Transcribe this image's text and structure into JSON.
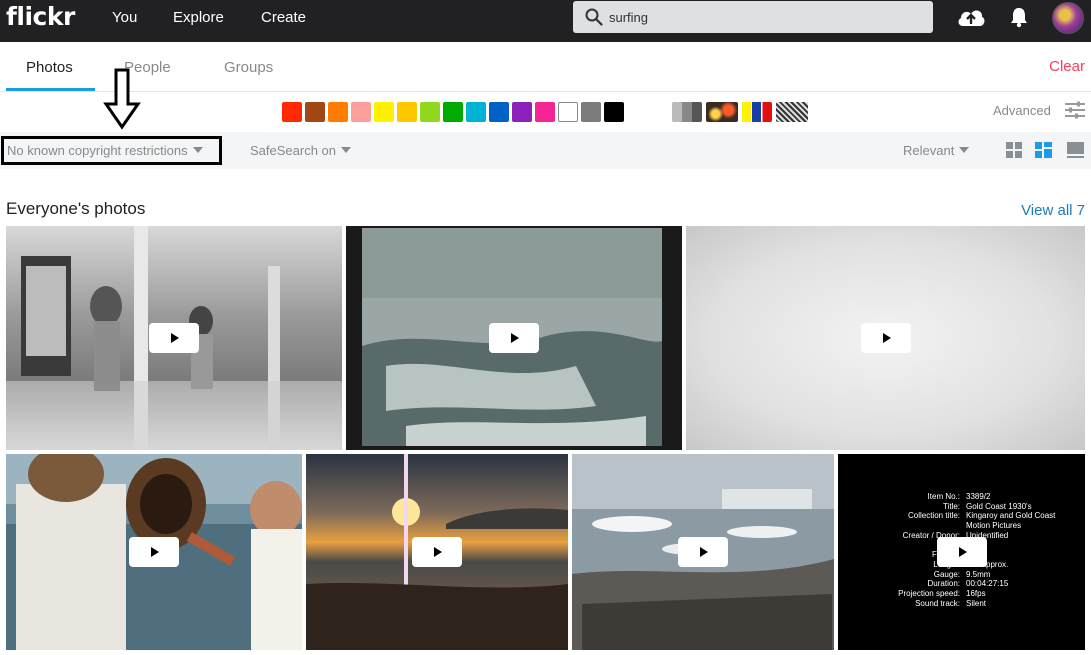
{
  "header": {
    "logo": "flickr",
    "nav": [
      "You",
      "Explore",
      "Create"
    ],
    "search_value": "surfing"
  },
  "tabs": {
    "items": [
      "Photos",
      "People",
      "Groups"
    ],
    "active": "Photos",
    "clear": "Clear"
  },
  "colors": {
    "swatches": [
      "#ff2a00",
      "#a14713",
      "#ff7c00",
      "#ff9f9c",
      "#fff100",
      "#ffc700",
      "#8fd81d",
      "#00ab00",
      "#00b2d4",
      "#0062c6",
      "#8c20ba",
      "#f52394",
      "#ffffff",
      "#7c7c7c",
      "#000000"
    ],
    "accent": "#1c9be9",
    "clear_color": "#ff3b5c"
  },
  "filters": {
    "license": "No known copyright restrictions",
    "safesearch": "SafeSearch on",
    "sort": "Relevant",
    "advanced": "Advanced"
  },
  "section": {
    "title": "Everyone's photos",
    "view_all": "View all 7"
  },
  "video_card": {
    "lines": [
      {
        "k": "Item No.:",
        "v": "3389/2"
      },
      {
        "k": "Title:",
        "v": "Gold Coast 1930's"
      },
      {
        "k": "Collection title:",
        "v": "Kingaroy and Gold Coast"
      },
      {
        "k": "",
        "v": "Motion Pictures"
      },
      {
        "k": "Creator / Donor:",
        "v": "Unidentified"
      },
      {
        "k": "Da",
        "v": ""
      },
      {
        "k": "Film typ",
        "v": "ansal"
      },
      {
        "k": "Length:",
        "v": "20ft approx."
      },
      {
        "k": "Gauge:",
        "v": "9.5mm"
      },
      {
        "k": "Duration:",
        "v": "00:04:27:15"
      },
      {
        "k": "Projection speed:",
        "v": "16fps"
      },
      {
        "k": "Sound track:",
        "v": "Silent"
      }
    ]
  }
}
